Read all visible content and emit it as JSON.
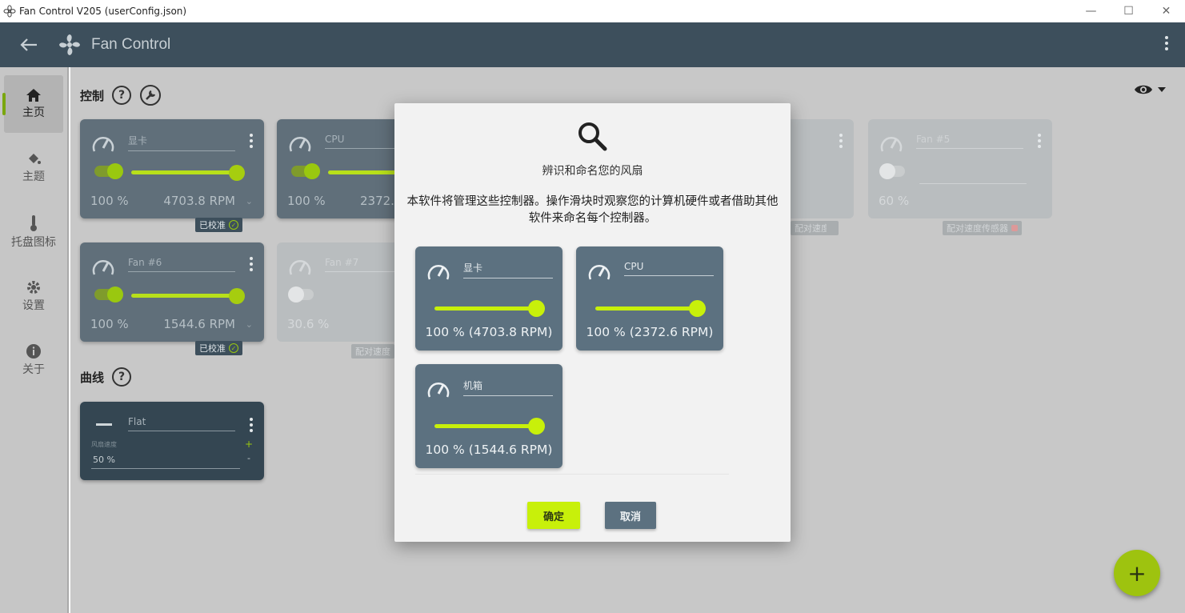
{
  "window": {
    "title": "Fan Control V205 (userConfig.json)",
    "minimize": "—",
    "maximize": "☐",
    "close": "✕"
  },
  "appbar": {
    "title": "Fan Control"
  },
  "sidebar": {
    "items": [
      {
        "label": "主页",
        "icon": "home-icon",
        "active": true
      },
      {
        "label": "主题",
        "icon": "paint-bucket-icon"
      },
      {
        "label": "托盘图标",
        "icon": "thermometer-icon"
      },
      {
        "label": "设置",
        "icon": "gear-icon"
      },
      {
        "label": "关于",
        "icon": "info-icon"
      }
    ]
  },
  "main": {
    "controls_title": "控制",
    "curves_title": "曲线",
    "controls": [
      {
        "name": "显卡",
        "percent": "100 %",
        "rpm": "4703.8 RPM",
        "badge": "已校准"
      },
      {
        "name": "CPU",
        "percent": "100 %",
        "rpm": "2372."
      },
      {
        "name": "Fan #5",
        "percent": "60 %",
        "badge": "配对速度传感器"
      },
      {
        "name": "Fan #6",
        "percent": "100 %",
        "rpm": "1544.6 RPM",
        "badge": "已校准"
      },
      {
        "name": "Fan #7",
        "percent": "30.6 %",
        "badge": "配对速度"
      },
      {
        "badge": "配对速度传感器"
      }
    ],
    "curve": {
      "name": "Flat",
      "sub_label": "风扇速度",
      "value": "50 %",
      "plus": "+",
      "minus": "-"
    }
  },
  "dialog": {
    "title": "辨识和命名您的风扇",
    "description": "本软件将管理这些控制器。操作滑块时观察您的计算机硬件或者借助其他软件来命名每个控制器。",
    "fans": [
      {
        "name": "显卡",
        "reading": "100 %  (4703.8 RPM)",
        "level": 1.0
      },
      {
        "name": "CPU",
        "reading": "100 %  (2372.6 RPM)",
        "level": 1.0
      },
      {
        "name": "机箱",
        "reading": "100 %  (1544.6 RPM)",
        "level": 1.0
      }
    ],
    "ok_label": "确定",
    "cancel_label": "取消"
  },
  "fab": {
    "label": "+"
  },
  "colors": {
    "accent": "#c8f00a",
    "appbar": "#3d4f5c",
    "card": "#5c7180"
  }
}
